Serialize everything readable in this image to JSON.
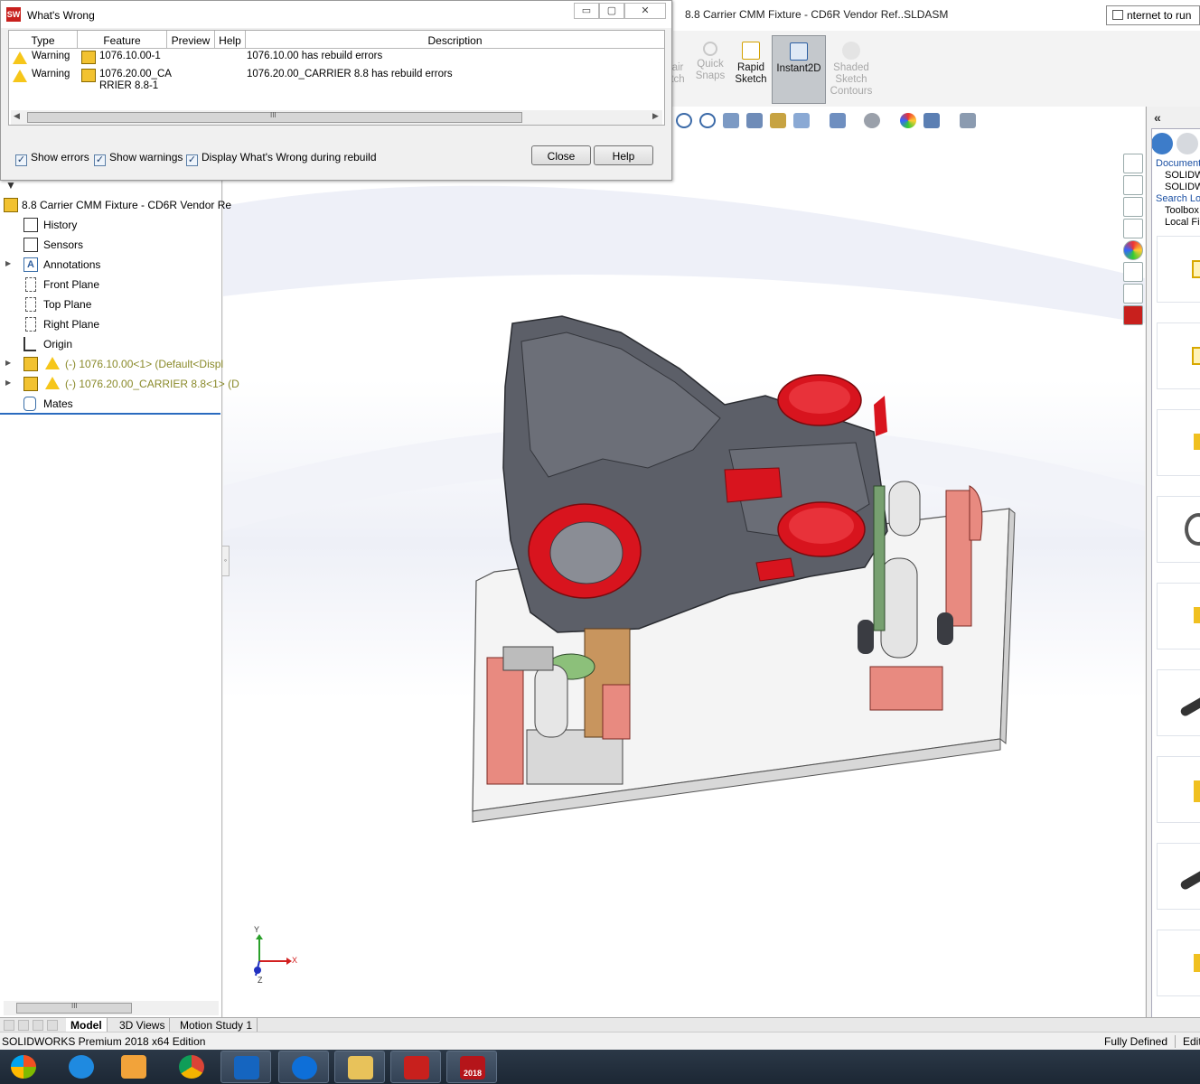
{
  "dialog": {
    "title": "What's Wrong",
    "columns": [
      "Type",
      "Feature",
      "Preview",
      "Help",
      "Description"
    ],
    "rows": [
      {
        "type": "Warning",
        "feature": "1076.10.00-1",
        "feature_line2": "",
        "description": "1076.10.00 has rebuild errors"
      },
      {
        "type": "Warning",
        "feature": "1076.20.00_CA",
        "feature_line2": "RRIER 8.8-1",
        "description": "1076.20.00_CARRIER 8.8 has rebuild errors"
      }
    ],
    "scroll_grip": "III",
    "options": {
      "show_errors": "Show errors",
      "show_warnings": "Show warnings",
      "display_during_rebuild": "Display What's Wrong during rebuild"
    },
    "buttons": {
      "close": "Close",
      "help": "Help"
    },
    "win_buttons": {
      "minimize": "▭",
      "restore": "▢",
      "close": "✕"
    }
  },
  "window": {
    "title": "8.8 Carrier CMM Fixture - CD6R Vendor Ref..SLDASM",
    "search_text": "nternet to run"
  },
  "command_manager": {
    "items": [
      {
        "label": "air\ntch",
        "state": "disabled"
      },
      {
        "label": "Quick\nSnaps",
        "state": "disabled"
      },
      {
        "label": "Rapid\nSketch",
        "state": "enabled"
      },
      {
        "label": "Instant2D",
        "state": "active"
      },
      {
        "label": "Shaded\nSketch\nContours",
        "state": "disabled"
      }
    ]
  },
  "feature_tree": {
    "filter_icon": "funnel-icon",
    "root": "8.8 Carrier CMM Fixture - CD6R Vendor Re",
    "items": [
      {
        "label": "History",
        "icon": "history-icon"
      },
      {
        "label": "Sensors",
        "icon": "sensors-icon"
      },
      {
        "label": "Annotations",
        "icon": "annotations-icon"
      },
      {
        "label": "Front Plane",
        "icon": "plane-icon"
      },
      {
        "label": "Top Plane",
        "icon": "plane-icon"
      },
      {
        "label": "Right Plane",
        "icon": "plane-icon"
      },
      {
        "label": "Origin",
        "icon": "origin-icon"
      },
      {
        "label": "(-) 1076.10.00<1> (Default<Displ",
        "icon": "part-warning-icon"
      },
      {
        "label": "(-) 1076.20.00_CARRIER 8.8<1> (D",
        "icon": "part-warning-icon"
      },
      {
        "label": "Mates",
        "icon": "mates-icon"
      }
    ],
    "scroll_grip": "III"
  },
  "task_pane": {
    "links": [
      "Document",
      "SOLIDW",
      "SOLIDW",
      "Search Loc",
      "Toolbox",
      "Local Fil"
    ]
  },
  "triad": {
    "x": "X",
    "y": "Y",
    "z": "Z"
  },
  "bottom_tabs": [
    "Model",
    "3D Views",
    "Motion Study 1"
  ],
  "status_bar": {
    "product": "SOLIDWORKS Premium 2018 x64 Edition",
    "state": "Fully Defined",
    "edit": "Edit"
  },
  "taskbar": {
    "apps": [
      "Start",
      "Internet Explorer",
      "Media Player",
      "Chrome",
      "Outlook",
      "TeamViewer",
      "File Explorer",
      "AutoCAD",
      "SOLIDWORKS 2018"
    ],
    "sw_badge": "2018"
  },
  "colors": {
    "accent_blue": "#2a6bbf",
    "model_grey": "#5c5f68",
    "feature_red": "#d8141e",
    "fixture_salmon": "#e88a80",
    "warning_yellow": "#f6c61a"
  }
}
